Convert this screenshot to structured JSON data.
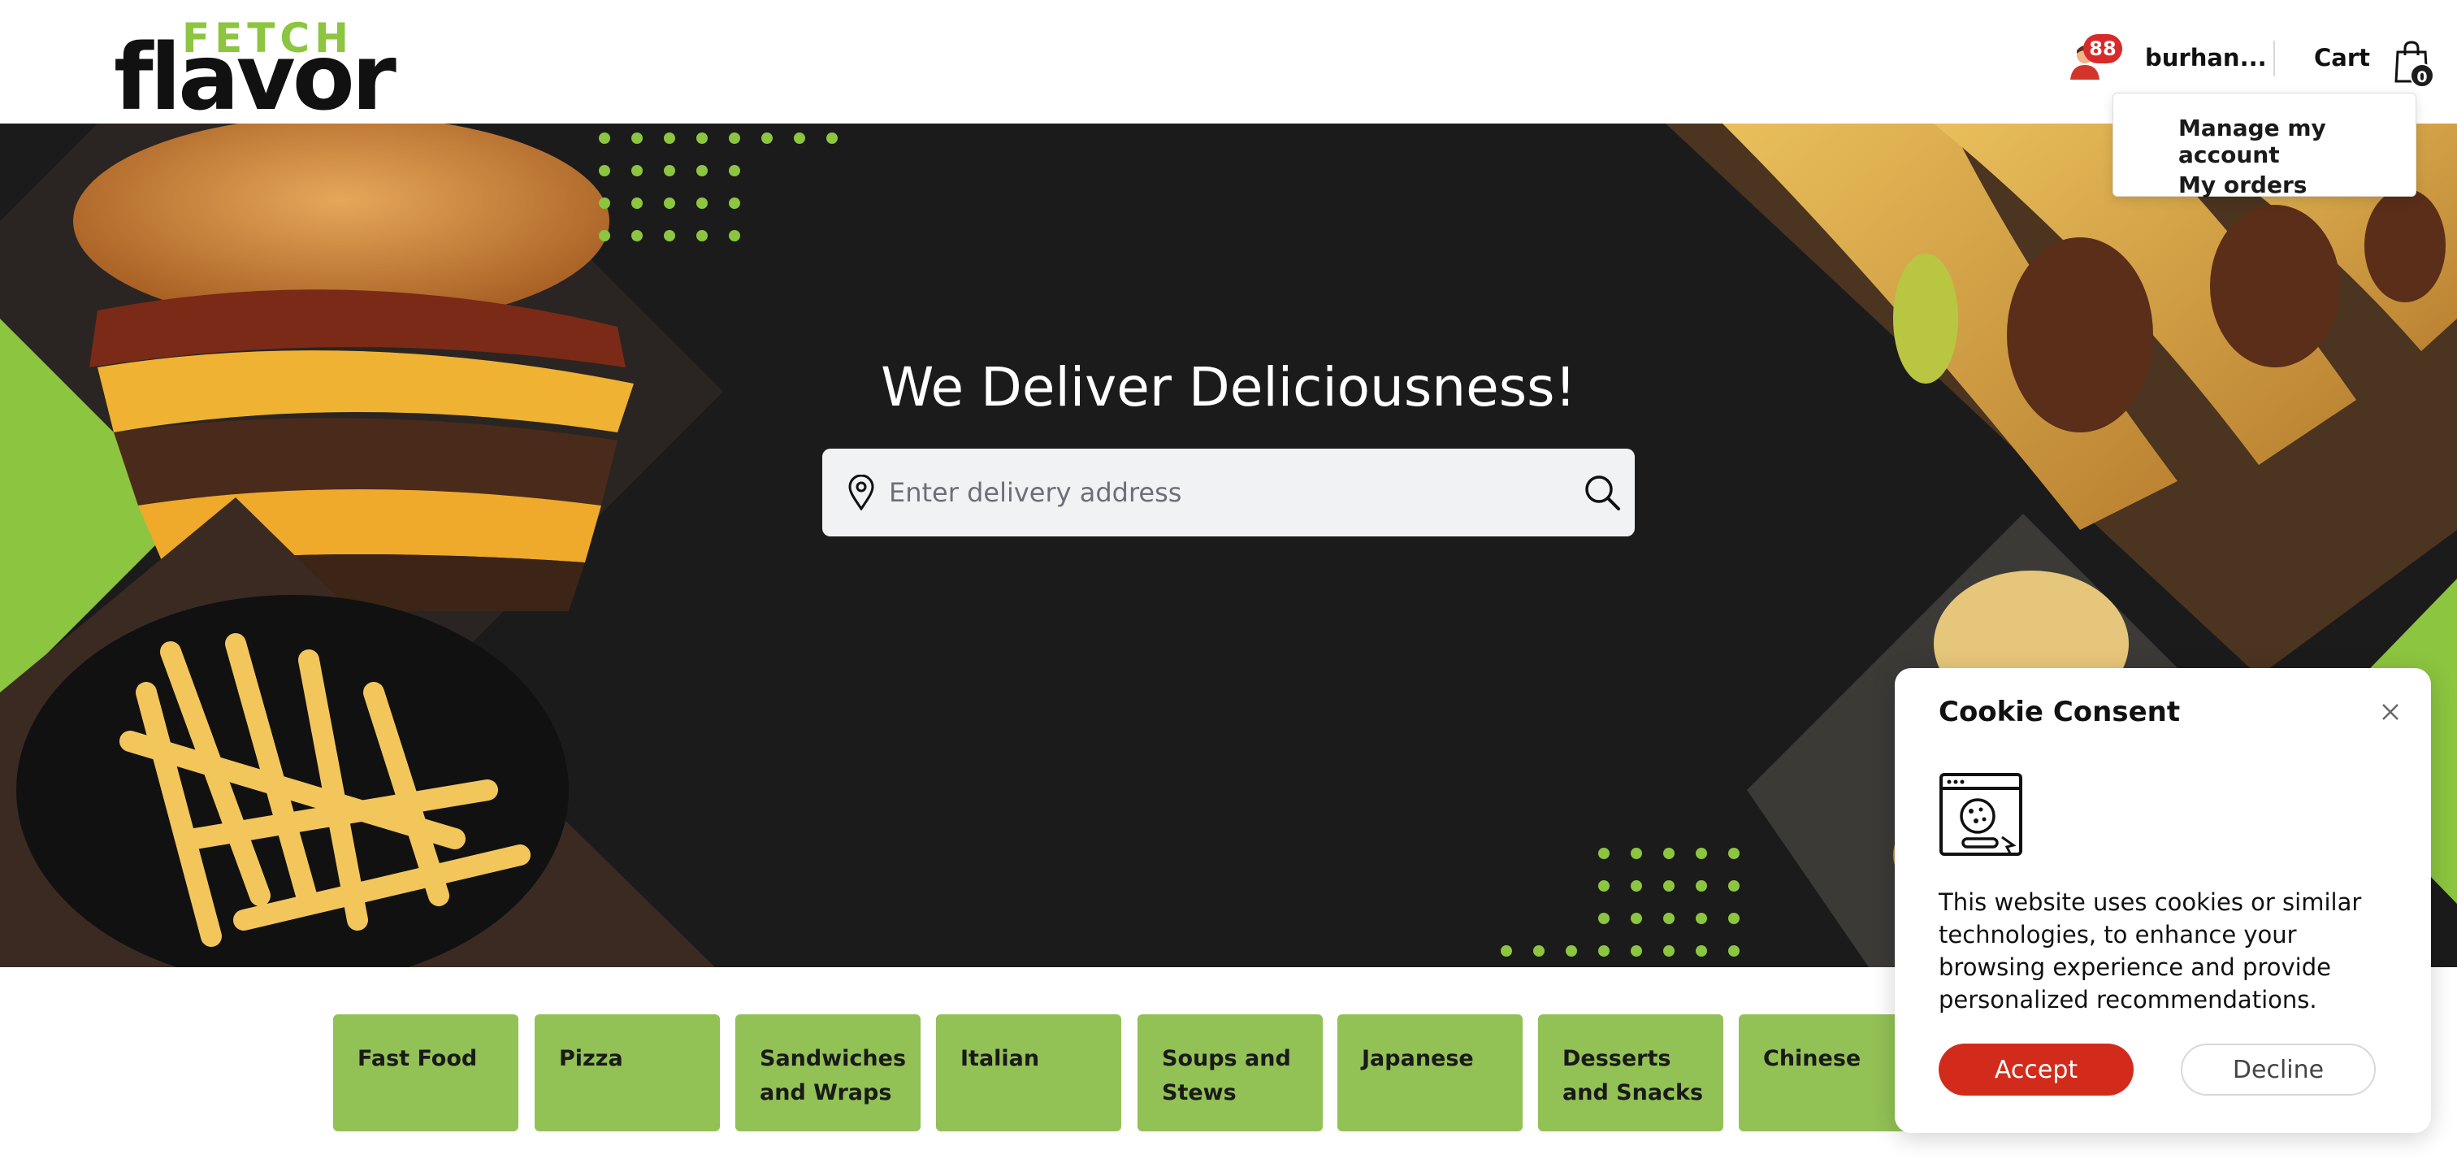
{
  "brand": {
    "logo_top": "FETCH",
    "logo_bottom": "flavor",
    "accent_color": "#8cc53f"
  },
  "header": {
    "notification_count": "88",
    "username": "burhan...",
    "cart_label": "Cart",
    "cart_count": "0"
  },
  "account_menu": {
    "items": [
      {
        "label": "Manage my account"
      },
      {
        "label": "My orders"
      }
    ]
  },
  "hero": {
    "title": "We Deliver Deliciousness!",
    "search": {
      "placeholder": "Enter delivery address",
      "value": ""
    }
  },
  "categories": [
    {
      "label": "Fast Food"
    },
    {
      "label": "Pizza"
    },
    {
      "label": "Sandwiches and Wraps"
    },
    {
      "label": "Italian"
    },
    {
      "label": "Soups and Stews"
    },
    {
      "label": "Japanese"
    },
    {
      "label": "Desserts and Snacks"
    },
    {
      "label": "Chinese"
    }
  ],
  "cookie": {
    "title": "Cookie Consent",
    "text": "This website uses cookies or similar technologies, to enhance your browsing experience and provide personalized recommendations.",
    "accept_label": "Accept",
    "decline_label": "Decline",
    "accept_color": "#d22b1c"
  },
  "icons": {
    "avatar": "user-avatar-icon",
    "cart": "shopping-bag-icon",
    "pin": "location-pin-icon",
    "search": "search-icon",
    "close": "close-icon",
    "cookie": "cookie-browser-icon"
  }
}
